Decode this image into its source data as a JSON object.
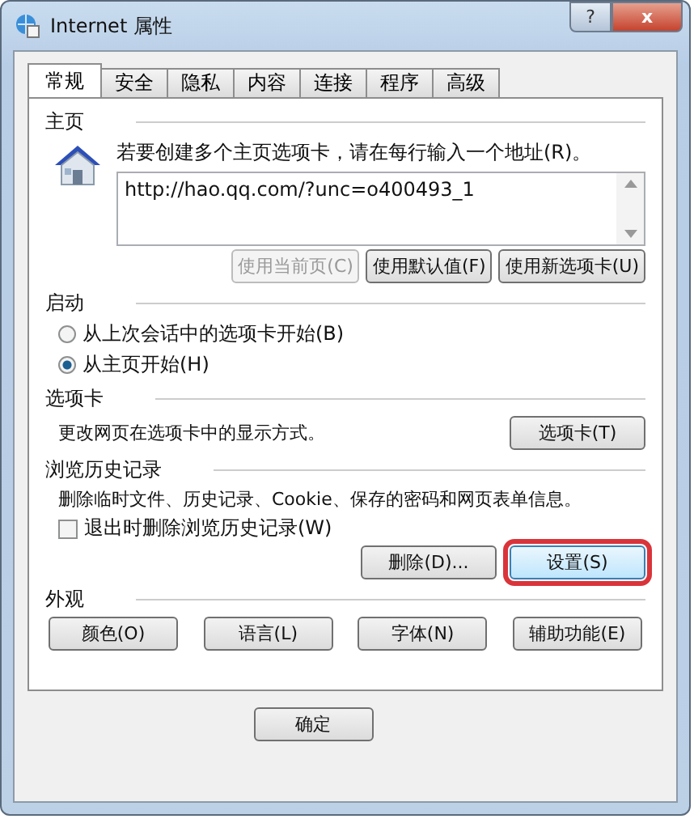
{
  "window": {
    "title": "Internet 属性",
    "help": "?",
    "close": "x"
  },
  "tabs": [
    {
      "label": "常规",
      "selected": true
    },
    {
      "label": "安全",
      "selected": false
    },
    {
      "label": "隐私",
      "selected": false
    },
    {
      "label": "内容",
      "selected": false
    },
    {
      "label": "连接",
      "selected": false
    },
    {
      "label": "程序",
      "selected": false
    },
    {
      "label": "高级",
      "selected": false
    }
  ],
  "home": {
    "heading": "主页",
    "hint": "若要创建多个主页选项卡，请在每行输入一个地址(R)。",
    "value": "http://hao.qq.com/?unc=o400493_1",
    "buttons": [
      {
        "label": "使用当前页(C)",
        "disabled": true
      },
      {
        "label": "使用默认值(F)",
        "disabled": false
      },
      {
        "label": "使用新选项卡(U)",
        "disabled": false
      }
    ]
  },
  "startup": {
    "heading": "启动",
    "options": [
      {
        "label": "从上次会话中的选项卡开始(B)",
        "selected": false
      },
      {
        "label": "从主页开始(H)",
        "selected": true
      }
    ]
  },
  "tabs_section": {
    "heading": "选项卡",
    "text": "更改网页在选项卡中的显示方式。",
    "button": "选项卡(T)"
  },
  "history": {
    "heading": "浏览历史记录",
    "text": "删除临时文件、历史记录、Cookie、保存的密码和网页表单信息。",
    "checkbox": {
      "label": "退出时删除浏览历史记录(W)",
      "checked": false
    },
    "buttons": [
      {
        "label": "删除(D)...",
        "highlighted": false
      },
      {
        "label": "设置(S)",
        "highlighted": true
      }
    ]
  },
  "appearance": {
    "heading": "外观",
    "buttons": [
      "颜色(O)",
      "语言(L)",
      "字体(N)",
      "辅助功能(E)"
    ]
  },
  "footer": {
    "buttons": [
      "确定"
    ]
  }
}
